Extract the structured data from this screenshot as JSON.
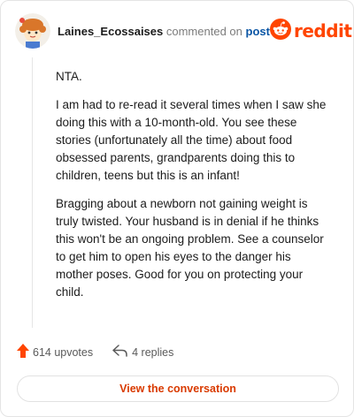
{
  "header": {
    "username": "Laines_Ecossaises",
    "action_text": "commented on",
    "post_link_text": "post",
    "brand_text": "reddit"
  },
  "comment": {
    "paragraphs": [
      "NTA.",
      "I am had to re-read it several times when I saw she doing this with a 10-month-old. You see these stories (unfortunately all the time) about food obsessed parents, grandparents doing this to children, teens but this is an infant!",
      "Bragging about a newborn not gaining weight is truly twisted. Your husband is in denial if he thinks this won't be an ongoing problem. See a counselor to get him to open his eyes to the danger his mother poses. Good for you on protecting your child."
    ]
  },
  "footer": {
    "upvotes_label": "614 upvotes",
    "replies_label": "4 replies",
    "view_button_label": "View the conversation"
  },
  "colors": {
    "brand": "#ff4500",
    "link": "#0b56a5",
    "button_text": "#d93a00",
    "upvote": "#ff4500"
  },
  "icons": {
    "avatar": "avatar",
    "brand": "reddit-logo-icon",
    "upvote": "upvote-arrow-icon",
    "reply": "reply-arrow-icon"
  }
}
